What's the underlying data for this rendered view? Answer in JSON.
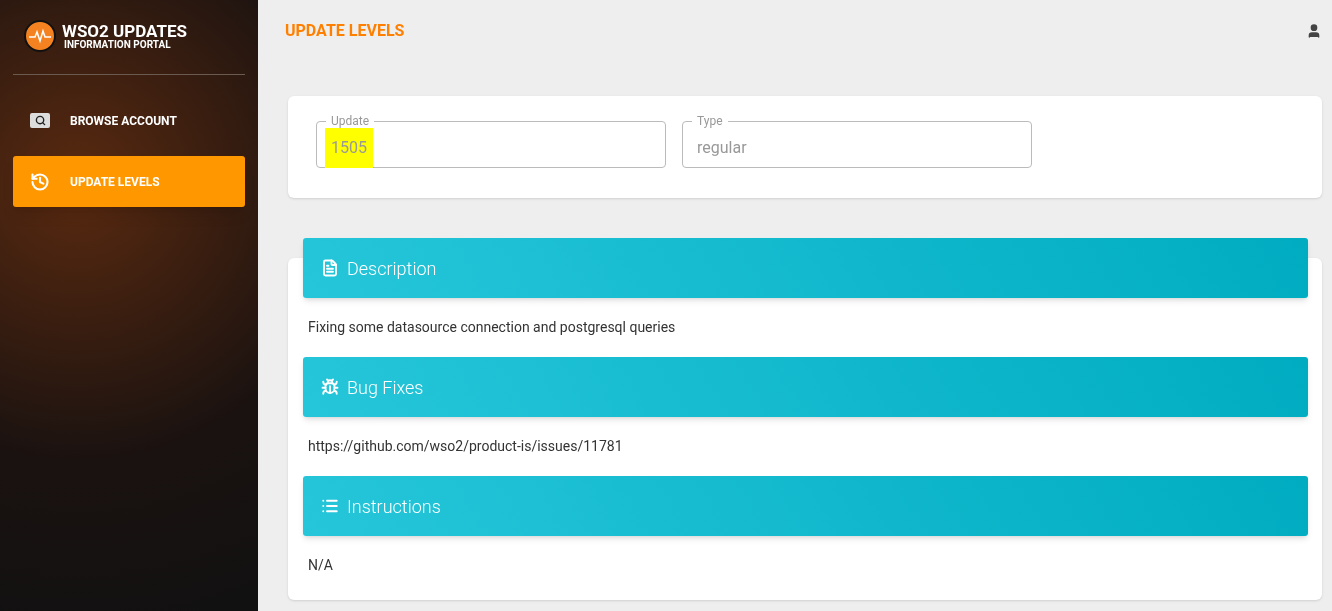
{
  "sidebar": {
    "brand": {
      "title": "WSO2 UPDATES",
      "subtitle": "INFORMATION PORTAL"
    },
    "items": [
      {
        "label": "BROWSE ACCOUNT",
        "kind": "search",
        "selected": false
      },
      {
        "label": "UPDATE LEVELS",
        "kind": "history",
        "selected": true
      }
    ]
  },
  "header": {
    "title": "UPDATE LEVELS"
  },
  "fields": [
    {
      "label": "Update",
      "value": "1505",
      "highlighted": true
    },
    {
      "label": "Type",
      "value": "regular",
      "highlighted": false
    }
  ],
  "sections": [
    {
      "title": "Description",
      "kind": "document",
      "body": "Fixing some datasource connection and postgresql queries"
    },
    {
      "title": "Bug Fixes",
      "kind": "bug",
      "body": "https://github.com/wso2/product-is/issues/11781"
    },
    {
      "title": "Instructions",
      "kind": "list",
      "body": "N/A"
    }
  ]
}
